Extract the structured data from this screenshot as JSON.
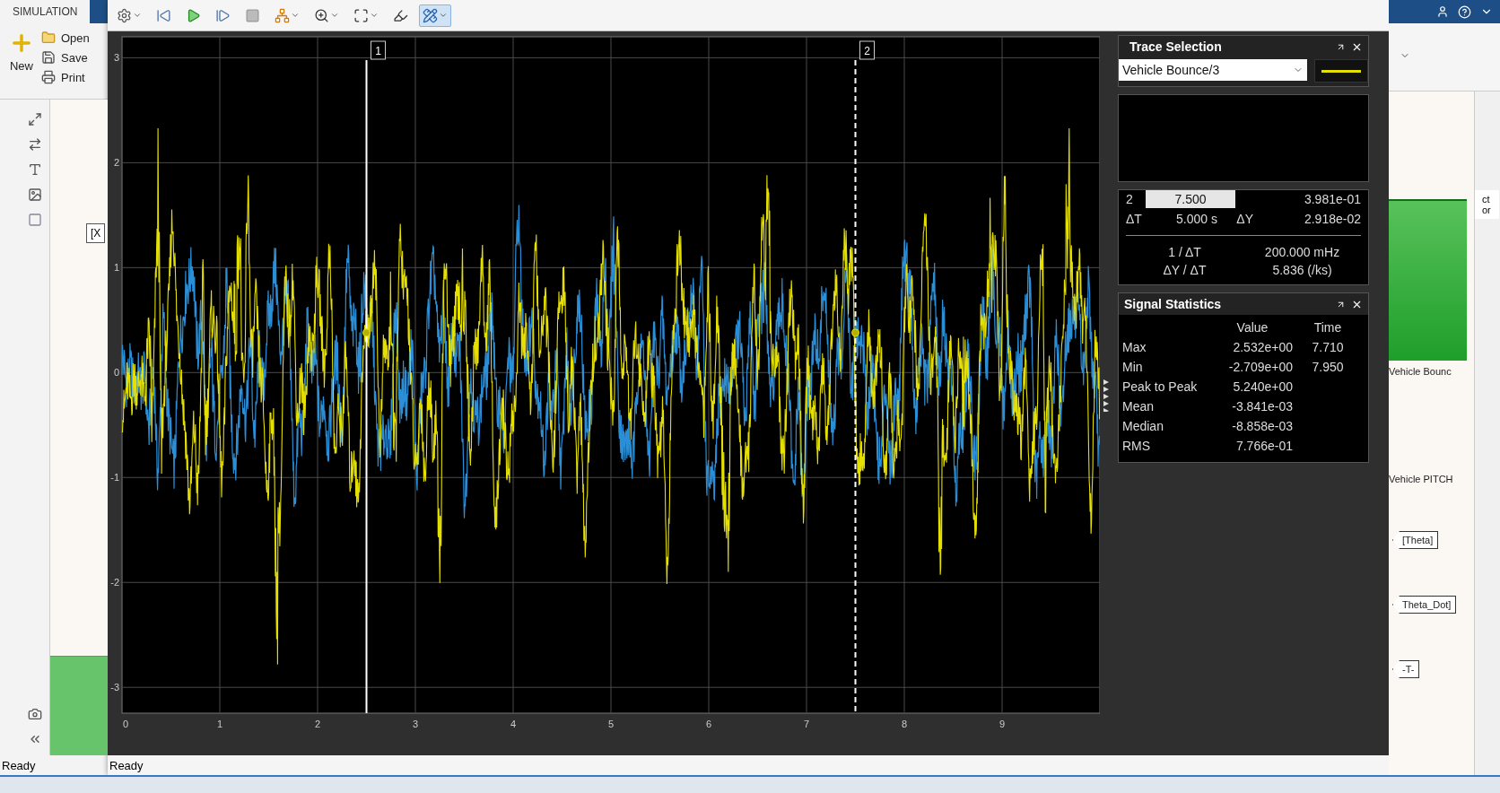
{
  "simulink": {
    "tab": "SIMULATION",
    "file_buttons": [
      {
        "kind": "new",
        "label": "New"
      },
      {
        "kind": "open",
        "label": "Open"
      },
      {
        "kind": "save",
        "label": "Save"
      },
      {
        "kind": "print",
        "label": "Print"
      }
    ],
    "tag": "[X",
    "status": "Ready"
  },
  "scope": {
    "toolbar": [
      {
        "kind": "settings",
        "caret": true,
        "selected": false
      },
      {
        "kind": "restart",
        "caret": false,
        "selected": false
      },
      {
        "kind": "run",
        "caret": false,
        "selected": false
      },
      {
        "kind": "step",
        "caret": false,
        "selected": false
      },
      {
        "kind": "stop",
        "caret": false,
        "selected": false
      },
      {
        "kind": "signals",
        "caret": true,
        "selected": false
      },
      {
        "kind": "zoom",
        "caret": true,
        "selected": false
      },
      {
        "kind": "fit",
        "caret": true,
        "selected": false
      },
      {
        "kind": "highlight",
        "caret": false,
        "selected": false
      },
      {
        "kind": "measure",
        "caret": true,
        "selected": true
      }
    ],
    "axes": {
      "yticks": [
        "3",
        "2",
        "1",
        "0",
        "-1",
        "-2",
        "-3"
      ],
      "xticks": [
        "0",
        "1",
        "2",
        "3",
        "4",
        "5",
        "6",
        "7",
        "8",
        "9"
      ]
    },
    "cursors": [
      {
        "label": "1",
        "kind": "solid"
      },
      {
        "label": "2",
        "kind": "dashed"
      }
    ],
    "status": "Ready"
  },
  "trace_selection": {
    "title": "Trace Selection",
    "signal": "Vehicle Bounce/3",
    "color": "#e6e000"
  },
  "cursor_measurements": {
    "rows": [
      {
        "label": "2",
        "time": "7.500",
        "value": "3.981e-01"
      }
    ],
    "deltas": {
      "dt_label": "ΔT",
      "dt": "5.000 s",
      "dy_label": "ΔY",
      "dy": "2.918e-02"
    },
    "derived": [
      {
        "label": "1 / ΔT",
        "value": "200.000 mHz"
      },
      {
        "label": "ΔY / ΔT",
        "value": "5.836 (/ks)"
      }
    ]
  },
  "signal_statistics": {
    "title": "Signal Statistics",
    "columns": [
      "Value",
      "Time"
    ],
    "rows": [
      {
        "label": "Max",
        "value": "2.532e+00",
        "time": "7.710"
      },
      {
        "label": "Min",
        "value": "-2.709e+00",
        "time": "7.950"
      },
      {
        "label": "Peak to Peak",
        "value": "5.240e+00"
      },
      {
        "label": "Mean",
        "value": "-3.841e-03"
      },
      {
        "label": "Median",
        "value": "-8.858e-03"
      },
      {
        "label": "RMS",
        "value": "7.766e-01"
      }
    ]
  },
  "model": {
    "labels": [
      "Vehicle Bounc",
      "Vehicle PITCH"
    ],
    "tags": [
      "[Theta]",
      "Theta_Dot]",
      "-T-"
    ],
    "side_tab": "ctor"
  }
}
